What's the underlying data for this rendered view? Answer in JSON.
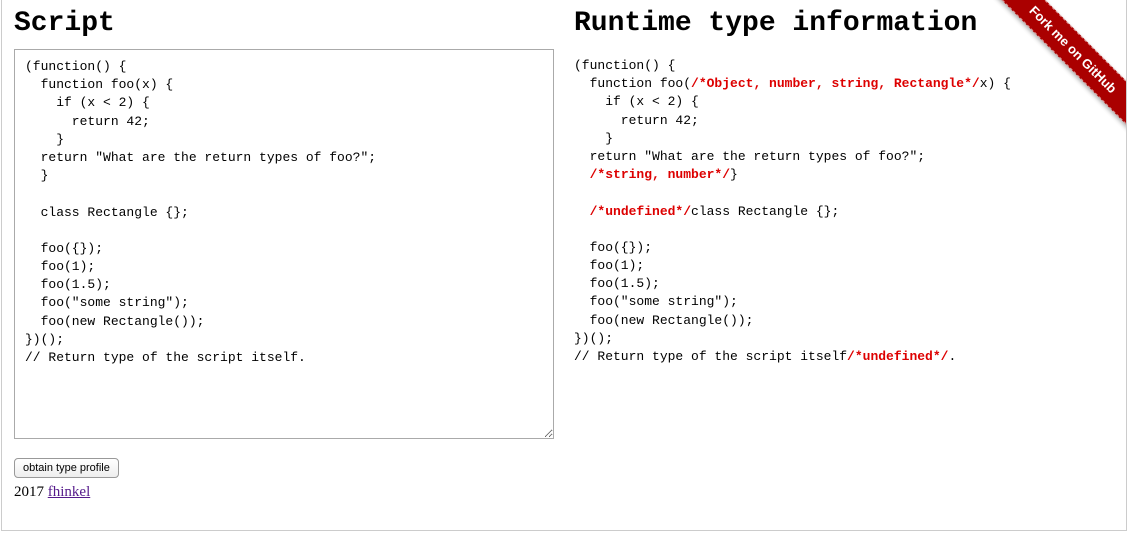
{
  "left": {
    "heading": "Script",
    "code": "(function() {\n  function foo(x) {\n    if (x < 2) {\n      return 42;\n    }\n  return \"What are the return types of foo?\";\n  }\n\n  class Rectangle {};\n\n  foo({});\n  foo(1);\n  foo(1.5);\n  foo(\"some string\");\n  foo(new Rectangle());\n})();\n// Return type of the script itself."
  },
  "right": {
    "heading": "Runtime type information",
    "segments": [
      {
        "t": "(function() {\n  function foo("
      },
      {
        "t": "/*Object, number, string, Rectangle*/",
        "ann": true
      },
      {
        "t": "x) {\n    if (x < 2) {\n      return 42;\n    }\n  return \"What are the return types of foo?\";\n  "
      },
      {
        "t": "/*string, number*/",
        "ann": true
      },
      {
        "t": "}\n\n  "
      },
      {
        "t": "/*undefined*/",
        "ann": true
      },
      {
        "t": "class Rectangle {};\n\n  foo({});\n  foo(1);\n  foo(1.5);\n  foo(\"some string\");\n  foo(new Rectangle());\n})();\n// Return type of the script itself"
      },
      {
        "t": "/*undefined*/",
        "ann": true
      },
      {
        "t": "."
      }
    ]
  },
  "button": {
    "label": "obtain type profile"
  },
  "footer": {
    "year": "2017",
    "author": "fhinkel"
  },
  "ribbon": {
    "label": "Fork me on GitHub"
  }
}
